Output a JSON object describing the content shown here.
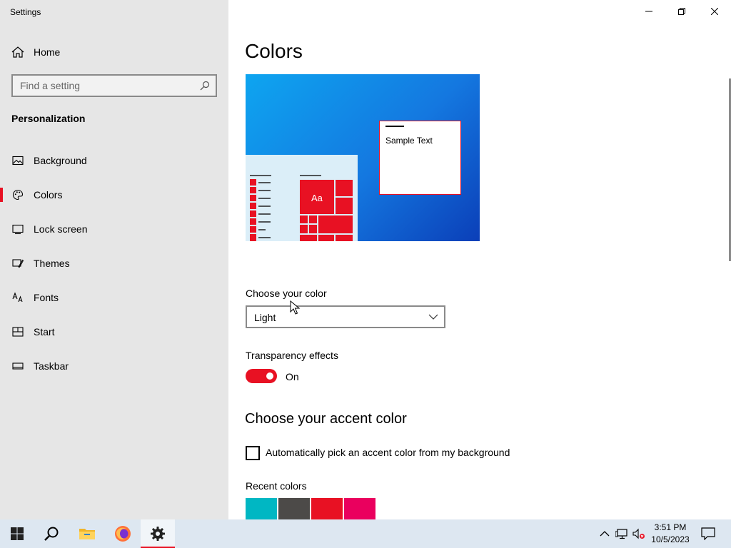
{
  "window": {
    "title": "Settings"
  },
  "sidebar": {
    "home_label": "Home",
    "search_placeholder": "Find a setting",
    "section_title": "Personalization",
    "items": [
      {
        "label": "Background",
        "icon": "picture-icon"
      },
      {
        "label": "Colors",
        "icon": "palette-icon",
        "selected": true
      },
      {
        "label": "Lock screen",
        "icon": "lock-screen-icon"
      },
      {
        "label": "Themes",
        "icon": "themes-icon"
      },
      {
        "label": "Fonts",
        "icon": "fonts-icon"
      },
      {
        "label": "Start",
        "icon": "start-icon"
      },
      {
        "label": "Taskbar",
        "icon": "taskbar-icon"
      }
    ]
  },
  "main": {
    "title": "Colors",
    "preview": {
      "sample_text": "Sample Text",
      "tile_label": "Aa"
    },
    "choose_color": {
      "label": "Choose your color",
      "value": "Light"
    },
    "transparency": {
      "label": "Transparency effects",
      "state": "On"
    },
    "accent": {
      "heading": "Choose your accent color",
      "auto_label": "Automatically pick an accent color from my background",
      "recent_label": "Recent colors",
      "recent_colors": [
        "#00b7c3",
        "#4c4a48",
        "#e81123",
        "#ea005e"
      ]
    }
  },
  "taskbar": {
    "time": "3:51 PM",
    "date": "10/5/2023"
  },
  "colors": {
    "accent": "#e81123",
    "sidebar_bg": "#e6e6e6",
    "taskbar_bg": "#dde7f1"
  }
}
